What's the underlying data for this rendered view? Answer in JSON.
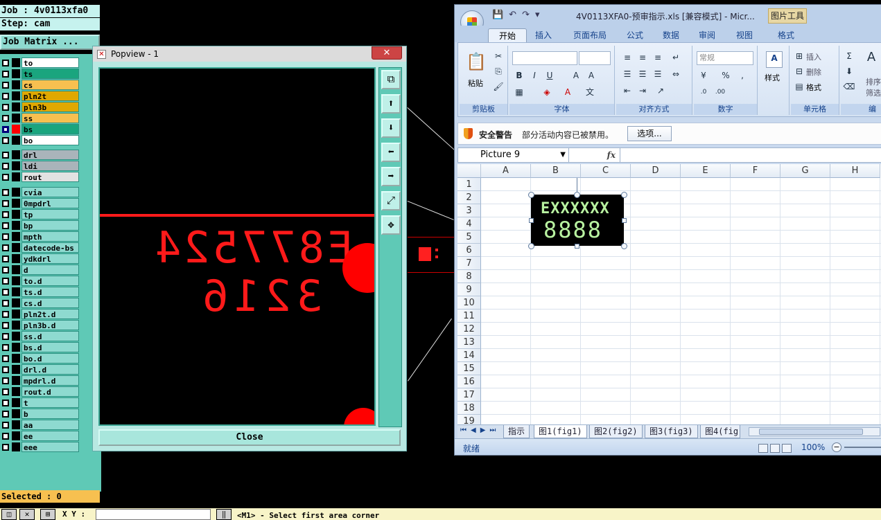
{
  "genesis": {
    "job_label": "Job : 4v0113xfa0",
    "step_label": "Step: cam",
    "job_matrix_label": "Job Matrix ...",
    "selected_label": "Selected : 0",
    "layers": [
      {
        "name": "to",
        "color": "#ffffff"
      },
      {
        "name": "ts",
        "color": "#1aa57e"
      },
      {
        "name": "cs",
        "color": "#f7c050"
      },
      {
        "name": "pln2t",
        "color": "#e0a800"
      },
      {
        "name": "pln3b",
        "color": "#e0a800"
      },
      {
        "name": "ss",
        "color": "#f7c050"
      },
      {
        "name": "bs",
        "color": "#1aa57e",
        "active": true
      },
      {
        "name": "bo",
        "color": "#ffffff"
      },
      {
        "name": "drl",
        "color": "#a9b4ba"
      },
      {
        "name": "ldi",
        "color": "#a9b4ba"
      },
      {
        "name": "rout",
        "color": "#e2e2e2"
      },
      {
        "name": "cvia",
        "color": "#8edad0"
      },
      {
        "name": "0mpdrl",
        "color": "#8edad0"
      },
      {
        "name": "tp",
        "color": "#8edad0"
      },
      {
        "name": "bp",
        "color": "#8edad0"
      },
      {
        "name": "mpth",
        "color": "#8edad0"
      },
      {
        "name": "datecode-bs",
        "color": "#8edad0"
      },
      {
        "name": "ydkdrl",
        "color": "#8edad0"
      },
      {
        "name": "d",
        "color": "#8edad0"
      },
      {
        "name": "to.d",
        "color": "#8edad0"
      },
      {
        "name": "ts.d",
        "color": "#8edad0"
      },
      {
        "name": "cs.d",
        "color": "#8edad0"
      },
      {
        "name": "pln2t.d",
        "color": "#8edad0"
      },
      {
        "name": "pln3b.d",
        "color": "#8edad0"
      },
      {
        "name": "ss.d",
        "color": "#8edad0"
      },
      {
        "name": "bs.d",
        "color": "#8edad0"
      },
      {
        "name": "bo.d",
        "color": "#8edad0"
      },
      {
        "name": "drl.d",
        "color": "#8edad0"
      },
      {
        "name": "mpdrl.d",
        "color": "#8edad0"
      },
      {
        "name": "rout.d",
        "color": "#8edad0"
      },
      {
        "name": "t",
        "color": "#8edad0"
      },
      {
        "name": "b",
        "color": "#8edad0"
      },
      {
        "name": "aa",
        "color": "#8edad0"
      },
      {
        "name": "ee",
        "color": "#8edad0"
      },
      {
        "name": "eee",
        "color": "#8edad0"
      }
    ],
    "bottom": {
      "xy_label": "X Y :",
      "xy_value": "",
      "status_message": "<M1> - Select first area corner"
    }
  },
  "popview": {
    "title": "Popview - 1",
    "close_label": "Close",
    "mirror_text_1": "E877524",
    "mirror_text_2": "3216",
    "tool_icons": [
      "zoom-home-icon",
      "pan-up-icon",
      "pan-down-icon",
      "pan-left-icon",
      "pan-right-icon",
      "zoom-fit-icon",
      "zoom-center-icon"
    ]
  },
  "excel": {
    "title": "4V0113XFA0-预审指示.xls  [兼容模式] - Micr...",
    "context_tab": "图片工具",
    "tabs": [
      "开始",
      "插入",
      "页面布局",
      "公式",
      "数据",
      "审阅",
      "视图",
      "格式"
    ],
    "groups": {
      "clipboard": "剪贴板",
      "font": "字体",
      "alignment": "对齐方式",
      "number": "数字",
      "styles": "样式",
      "cells": "单元格",
      "editing": "编"
    },
    "paste_label": "粘贴",
    "number_format": "常规",
    "cells_insert": "插入",
    "cells_delete": "删除",
    "cells_format": "格式",
    "sort_label": "排序",
    "filter_label": "筛选",
    "security": {
      "title": "安全警告",
      "message": "部分活动内容已被禁用。",
      "button": "选项..."
    },
    "name_box": "Picture 9",
    "fx_label": "fx",
    "columns": [
      "A",
      "B",
      "C",
      "D",
      "E",
      "F",
      "G",
      "H"
    ],
    "rows": [
      "1",
      "2",
      "3",
      "4",
      "5",
      "6",
      "7",
      "8",
      "9",
      "10",
      "11",
      "12",
      "13",
      "14",
      "15",
      "16",
      "17",
      "18",
      "19"
    ],
    "picture_line1": "EXXXXXX",
    "picture_line2": "8888",
    "sheets": [
      "指示",
      "图1(fig1)",
      "图2(fig2)",
      "图3(fig3)",
      "图4(fig"
    ],
    "status_ready": "就绪",
    "zoom": "100%"
  }
}
